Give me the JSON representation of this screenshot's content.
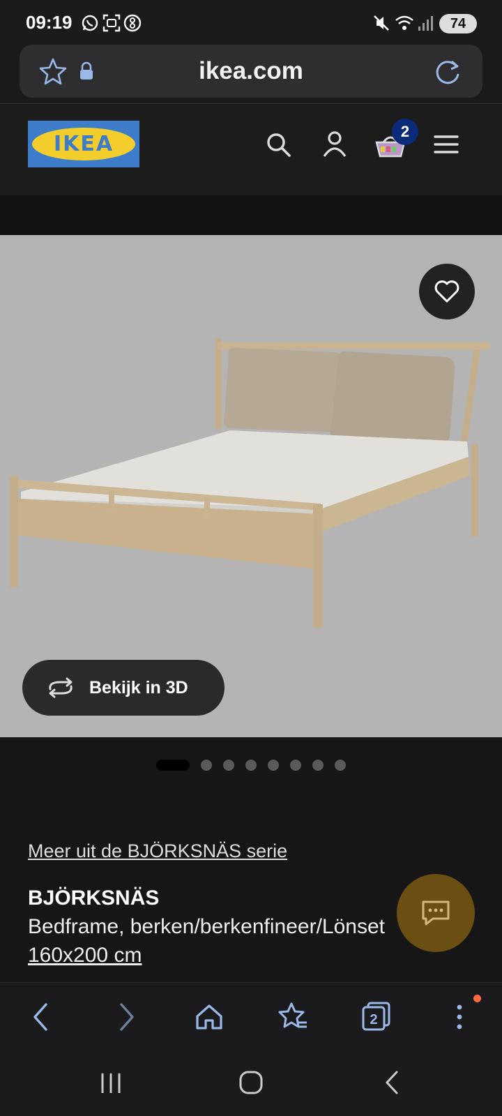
{
  "status_bar": {
    "time": "09:19",
    "battery": "74",
    "icons": [
      "whatsapp-icon",
      "screenshot-icon",
      "app-icon",
      "mute-icon",
      "wifi-icon",
      "signal-icon"
    ]
  },
  "browser": {
    "url": "ikea.com",
    "tab_count": "2"
  },
  "header": {
    "logo_text": "IKEA",
    "cart_count": "2",
    "brand_colors": {
      "blue": "#3d7cc9",
      "yellow": "#f2cd2c"
    }
  },
  "product_media": {
    "view3d_label": "Bekijk in 3D",
    "image_count": 8,
    "active_index": 0
  },
  "product": {
    "series_link": "Meer uit de BJÖRKSNÄS serie",
    "name": "BJÖRKSNÄS",
    "description": "Bedframe, berken/berkenfineer/Lönset",
    "size": "160x200 cm"
  },
  "colors": {
    "background": "#161616",
    "chat_button": "#6a4e12",
    "link": "#a9c8ff"
  }
}
